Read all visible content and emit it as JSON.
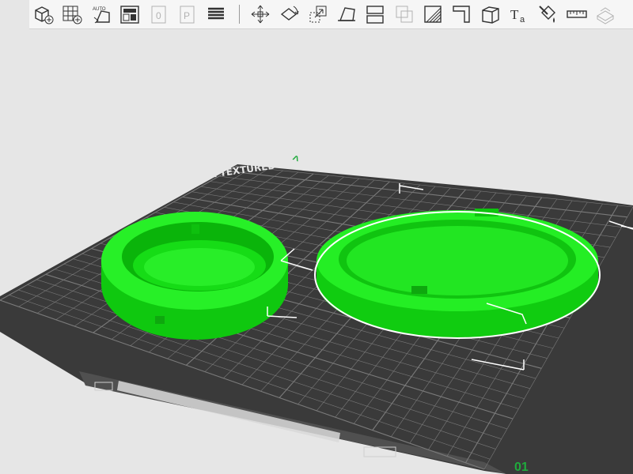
{
  "toolbar": {
    "items": [
      {
        "icon": "add-object-icon",
        "enabled": true
      },
      {
        "icon": "arrange-grid-icon",
        "enabled": true
      },
      {
        "icon": "auto-orient-icon",
        "label": "AUTO",
        "enabled": true
      },
      {
        "icon": "plate-layout-icon",
        "enabled": true
      },
      {
        "icon": "plate-zero-icon",
        "label": "0",
        "enabled": false
      },
      {
        "icon": "plate-p-icon",
        "label": "P",
        "enabled": false
      },
      {
        "icon": "layers-icon",
        "enabled": true
      },
      {
        "icon": "move-icon",
        "enabled": true
      },
      {
        "icon": "rotate-icon",
        "enabled": true
      },
      {
        "icon": "scale-icon",
        "enabled": true
      },
      {
        "icon": "lay-on-face-icon",
        "enabled": true
      },
      {
        "icon": "cut-icon",
        "enabled": true
      },
      {
        "icon": "boolean-icon",
        "enabled": false
      },
      {
        "icon": "support-paint-icon",
        "enabled": true
      },
      {
        "icon": "seam-paint-icon",
        "enabled": true
      },
      {
        "icon": "measure-box-icon",
        "enabled": true
      },
      {
        "icon": "text-icon",
        "label": "Ta",
        "enabled": true
      },
      {
        "icon": "color-paint-icon",
        "enabled": true
      },
      {
        "icon": "ruler-icon",
        "enabled": true
      },
      {
        "icon": "assembly-icon",
        "enabled": false
      }
    ]
  },
  "scene": {
    "axis_y_label": "^",
    "corner_label": "01",
    "object_color": "#17e017",
    "selected_outline": "#ffffff",
    "bed_color": "#3d3d3d",
    "grid_color": "#7a7a7a",
    "bed_edge_text": "SUPER TEXTURED PLATE"
  }
}
